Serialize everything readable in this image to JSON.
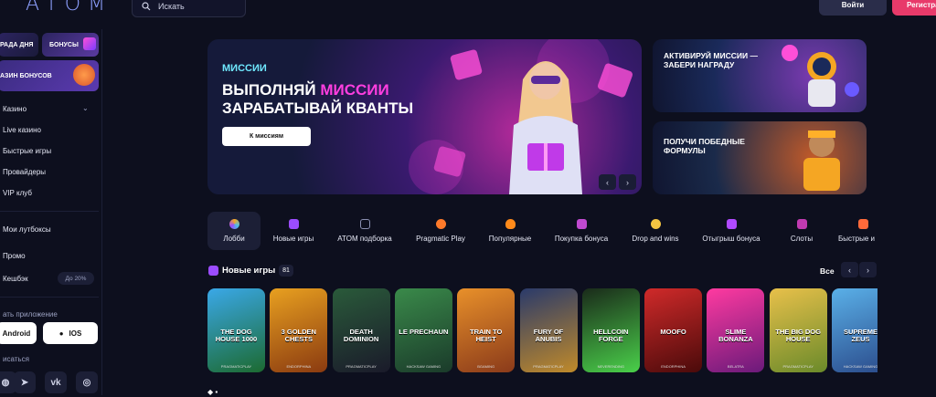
{
  "header": {
    "logo": "ATOM",
    "search_placeholder": "Искать",
    "login": "Войти",
    "register": "Регистрация"
  },
  "sidebar": {
    "promo_a": "РАДА ДНЯ",
    "promo_b": "БОНУСЫ",
    "promo_c": "АЗИН БОНУСОВ",
    "nav": [
      "Казино",
      "Live казино",
      "Быстрые игры",
      "Провайдеры",
      "VIP клуб"
    ],
    "nav2": [
      "Мои лутбоксы",
      "Промо",
      "Кешбэк"
    ],
    "cashback_badge": "До 20%",
    "app_title": "ать приложение",
    "android": "Android",
    "ios": "IOS",
    "subscribe": "исаться"
  },
  "hero": {
    "tag": "МИССИИ",
    "line1a": "ВЫПОЛНЯЙ ",
    "line1b": "МИССИИ",
    "line2": "ЗАРАБАТЫВАЙ КВАНТЫ",
    "button": "К миссиям"
  },
  "side_cards": [
    {
      "title": "АКТИВИРУЙ МИССИИ — ЗАБЕРИ НАГРАДУ"
    },
    {
      "title": "ПОЛУЧИ ПОБЕДНЫЕ ФОРМУЛЫ"
    }
  ],
  "tabs": [
    {
      "label": "Лобби",
      "color": "#f5a623"
    },
    {
      "label": "Новые игры",
      "color": "#9b4cff"
    },
    {
      "label": "ATOM подборка",
      "color": "#8a8fb0"
    },
    {
      "label": "Pragmatic Play",
      "color": "#ff7a2a"
    },
    {
      "label": "Популярные",
      "color": "#ff8a1a"
    },
    {
      "label": "Покупка бонуса",
      "color": "#c04ad0"
    },
    {
      "label": "Drop and wins",
      "color": "#f5c542"
    },
    {
      "label": "Отыгрыш бонуса",
      "color": "#b04aff"
    },
    {
      "label": "Слоты",
      "color": "#c03ab0"
    },
    {
      "label": "Быстрые и",
      "color": "#ff6a3a"
    }
  ],
  "new_games": {
    "title": "Новые игры",
    "count": "81",
    "all": "Все"
  },
  "games": [
    {
      "name": "THE DOG HOUSE 1000",
      "provider": "PRAGMATICPLAY",
      "c1": "#3aa8e8",
      "c2": "#1c6a30"
    },
    {
      "name": "3 GOLDEN CHESTS",
      "provider": "ENDORPHINA",
      "c1": "#e8a020",
      "c2": "#8a3a10"
    },
    {
      "name": "DEATH DOMINION",
      "provider": "PRAGMATICPLAY",
      "c1": "#2a5a3a",
      "c2": "#1a1a2a"
    },
    {
      "name": "LE PRECHAUN",
      "provider": "HACKSAW GAMING",
      "c1": "#3a8a4a",
      "c2": "#1a3a2a"
    },
    {
      "name": "TRAIN TO HEIST",
      "provider": "BGAMING",
      "c1": "#e8902a",
      "c2": "#8a3a1a"
    },
    {
      "name": "FURY OF ANUBIS",
      "provider": "PRAGMATICPLAY",
      "c1": "#2a3a6a",
      "c2": "#c08a2a"
    },
    {
      "name": "HELLCOIN FORGE",
      "provider": "NEVERENDING",
      "c1": "#1a2a1a",
      "c2": "#4ad04a"
    },
    {
      "name": "MOOFO",
      "provider": "ENDORPHINA",
      "c1": "#d02a2a",
      "c2": "#4a0a0a"
    },
    {
      "name": "SLIME BONANZA",
      "provider": "BELATRA",
      "c1": "#ff3aa0",
      "c2": "#6a1a7a"
    },
    {
      "name": "THE BIG DOG HOUSE",
      "provider": "PRAGMATICPLAY",
      "c1": "#e8c04a",
      "c2": "#6a8a2a"
    },
    {
      "name": "SUPREME ZEUS",
      "provider": "HACKSAW GAMING",
      "c1": "#5ab0e8",
      "c2": "#2a4a8a"
    }
  ]
}
